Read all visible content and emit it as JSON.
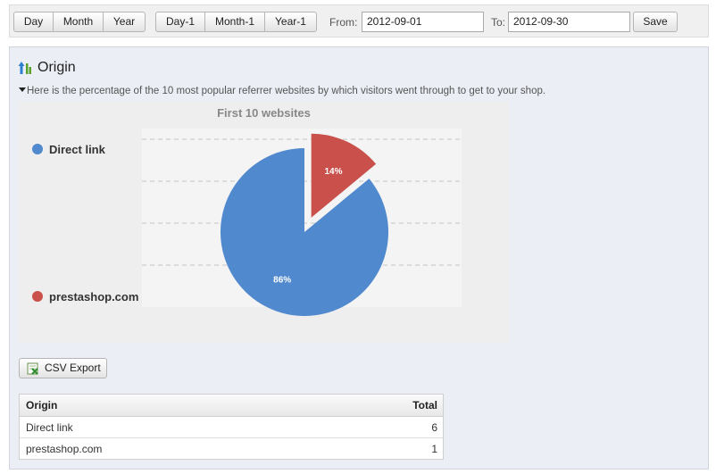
{
  "toolbar": {
    "period_buttons": [
      "Day",
      "Month",
      "Year"
    ],
    "previous_buttons": [
      "Day-1",
      "Month-1",
      "Year-1"
    ],
    "from_label": "From:",
    "from_value": "2012-09-01",
    "to_label": "To:",
    "to_value": "2012-09-30",
    "save_label": "Save"
  },
  "section": {
    "title": "Origin",
    "description": "Here is the percentage of the 10 most popular referrer websites by which visitors went through to get to your shop."
  },
  "chart_data": {
    "type": "pie",
    "title": "First 10 websites",
    "categories": [
      "Direct link",
      "prestashop.com"
    ],
    "values": [
      86,
      14
    ],
    "data_labels": [
      "86%",
      "14%"
    ],
    "colors": [
      "#5089cd",
      "#c9504b"
    ],
    "exploded_slice": "prestashop.com",
    "legend_placement": "left"
  },
  "csv_export": {
    "label": "CSV Export"
  },
  "table": {
    "columns": [
      "Origin",
      "Total"
    ],
    "rows": [
      {
        "origin": "Direct link",
        "total": "6"
      },
      {
        "origin": "prestashop.com",
        "total": "1"
      }
    ]
  }
}
